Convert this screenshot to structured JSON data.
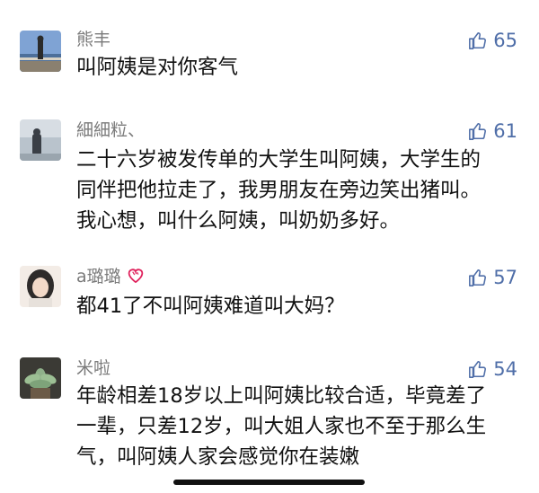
{
  "comments": [
    {
      "username": "熊丰",
      "likes": "65",
      "lines": [
        "叫阿姨是对你客气"
      ]
    },
    {
      "username": "細細粒、",
      "likes": "61",
      "lines": [
        "二十六岁被发传单的大学生叫阿姨，大学生的",
        "同伴把他拉走了，我男朋友在旁边笑出猪叫。",
        "我心想，叫什么阿姨，叫奶奶多好。"
      ]
    },
    {
      "username": "a璐璐",
      "likes": "57",
      "lines": [
        "都41了不叫阿姨难道叫大妈？"
      ]
    },
    {
      "username": "米啦",
      "likes": "54",
      "lines": [
        "年龄相差18岁以上叫阿姨比较合适，毕竟差了",
        "一辈，只差12岁，叫大姐人家也不至于那么生",
        "气，叫阿姨人家会感觉你在装嫩"
      ]
    }
  ],
  "colors": {
    "username": "#7a7a7a",
    "like": "#4f6ea8",
    "text": "#111111",
    "heart": "#e0245e"
  }
}
